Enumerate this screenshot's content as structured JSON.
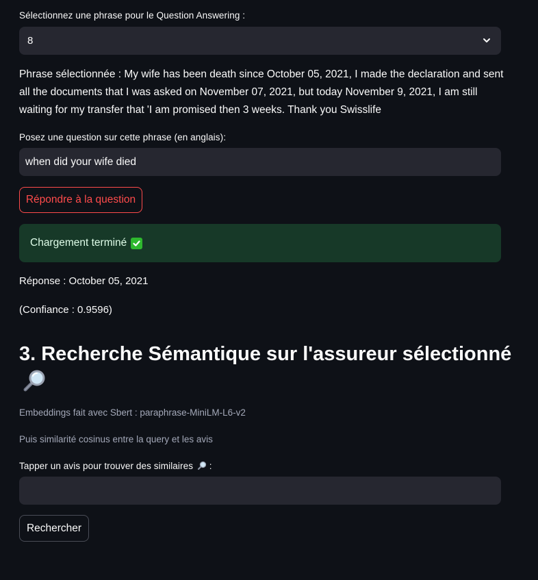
{
  "qa": {
    "select_label": "Sélectionnez une phrase pour le Question Answering :",
    "select_value": "8",
    "selected_sentence": "Phrase sélectionnée : My wife has been death since October 05, 2021, I made the declaration and sent all the documents that I was asked on November 07, 2021, but today November 9, 2021, I am still waiting for my transfer that 'I am promised then 3 weeks. Thank you Swisslife",
    "question_label": "Posez une question sur cette phrase (en anglais):",
    "question_value": "when did your wife died",
    "answer_button": "Répondre à la question",
    "status_text": "Chargement terminé",
    "answer_text": "Réponse : October 05, 2021",
    "confidence_text": "(Confiance : 0.9596)"
  },
  "semantic": {
    "heading": "3. Recherche Sémantique sur l'assureur sélectionné",
    "caption_model": "Embeddings fait avec Sbert : paraphrase-MiniLM-L6-v2",
    "caption_method": "Puis similarité cosinus entre la query et les avis",
    "input_label": "Tapper un avis pour trouver des similaires",
    "input_label_suffix": ":",
    "input_value": "",
    "search_button": "Rechercher"
  },
  "colors": {
    "background": "#0e1117",
    "input_bg": "#262730",
    "primary": "#ff4b4b",
    "success_bg": "#173928",
    "success_check": "#2eb82e"
  },
  "icons": {
    "select_chevron": "chevron-down-icon",
    "status_check": "check-mark-icon",
    "heading_icon": "magnifying-glass-icon",
    "label_icon": "magnifying-glass-icon"
  }
}
